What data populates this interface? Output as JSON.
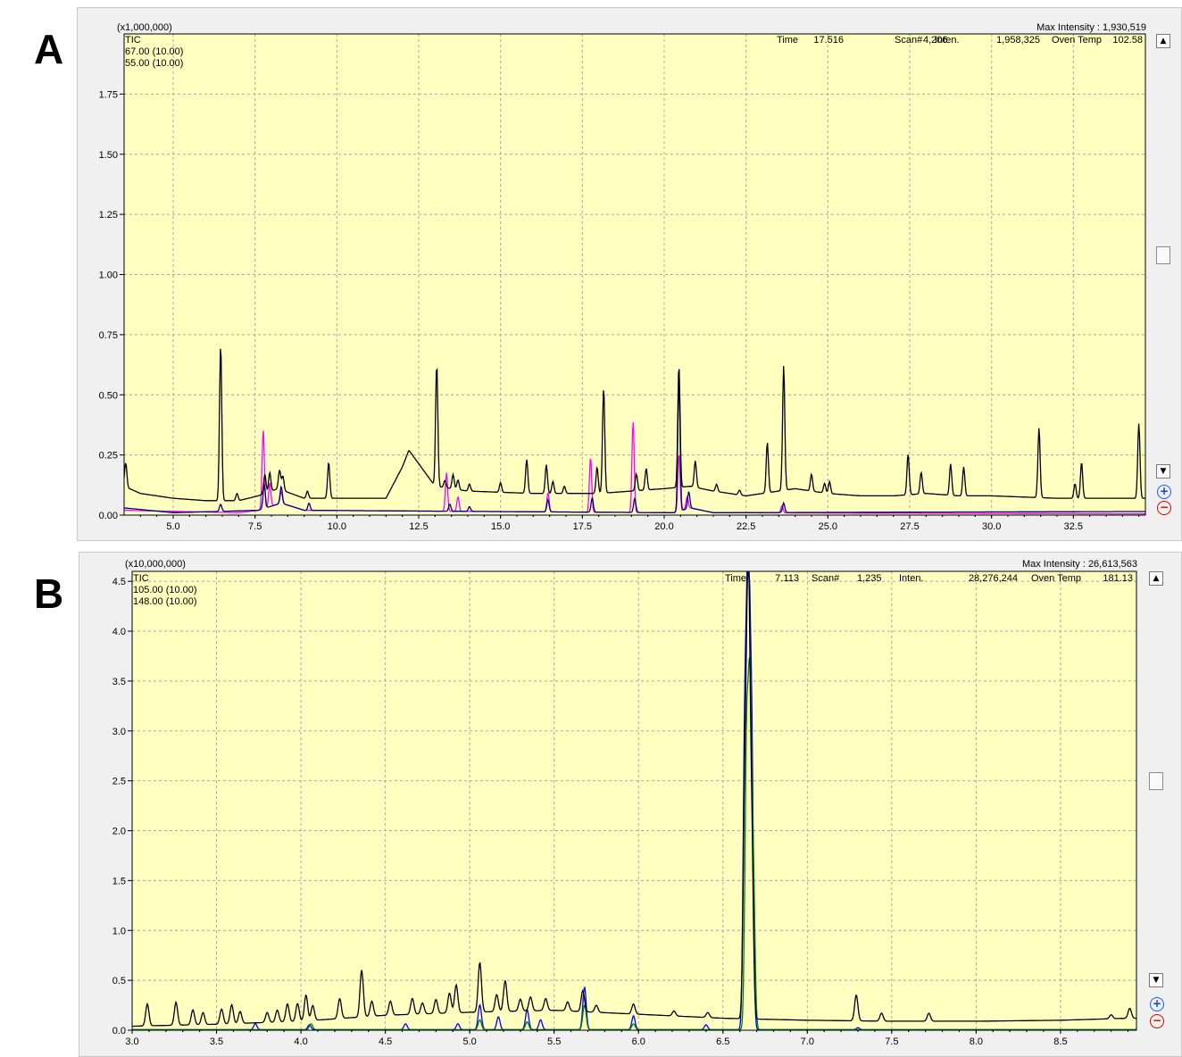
{
  "panels": [
    {
      "letter": "A",
      "y_multiplier": "(x1,000,000)",
      "max_intensity": "Max Intensity : 1,930,519",
      "status": {
        "time_label": "Time",
        "time": "17.516",
        "scan_label": "Scan#",
        "scan": "4,206",
        "inten_label": "Inten.",
        "inten": "1,958,325",
        "oven_label": "Oven Temp",
        "oven": "102.58"
      },
      "legend": [
        {
          "label": "TIC",
          "color": "#000000"
        },
        {
          "label": "67.00 (10.00)",
          "color": "#ff00ff"
        },
        {
          "label": "55.00 (10.00)",
          "color": "#000080"
        }
      ]
    },
    {
      "letter": "B",
      "y_multiplier": "(x10,000,000)",
      "max_intensity": "Max Intensity : 26,613,563",
      "status": {
        "time_label": "Time",
        "time": "7.113",
        "scan_label": "Scan#",
        "scan": "1,235",
        "inten_label": "Inten.",
        "inten": "28,276,244",
        "oven_label": "Oven Temp",
        "oven": "181.13"
      },
      "legend": [
        {
          "label": "TIC",
          "color": "#000000"
        },
        {
          "label": "105.00 (10.00)",
          "color": "#0000ff"
        },
        {
          "label": "148.00 (10.00)",
          "color": "#008000"
        }
      ]
    }
  ],
  "chart_data": [
    {
      "type": "line",
      "panel": "A",
      "xlim": [
        3.5,
        34.7
      ],
      "ylim": [
        0,
        2.0
      ],
      "x_ticks": [
        5.0,
        7.5,
        10.0,
        12.5,
        15.0,
        17.5,
        20.0,
        22.5,
        25.0,
        27.5,
        30.0,
        32.5
      ],
      "y_ticks": [
        0.0,
        0.25,
        0.5,
        0.75,
        1.0,
        1.25,
        1.5,
        1.75
      ],
      "x_tick_labels": [
        "5.0",
        "7.5",
        "10.0",
        "12.5",
        "15.0",
        "17.5",
        "20.0",
        "22.5",
        "25.0",
        "27.5",
        "30.0",
        "32.5"
      ],
      "y_tick_labels": [
        "0.00",
        "0.25",
        "0.50",
        "0.75",
        "1.00",
        "1.25",
        "1.50",
        "1.75"
      ],
      "grid": true,
      "background": "#ffffc0",
      "series": [
        {
          "name": "TIC",
          "color": "#000000",
          "baseline": [
            [
              3.5,
              0.12
            ],
            [
              4.0,
              0.09
            ],
            [
              5.0,
              0.07
            ],
            [
              6.0,
              0.06
            ],
            [
              7.0,
              0.06
            ],
            [
              7.6,
              0.08
            ],
            [
              8.2,
              0.11
            ],
            [
              9.0,
              0.07
            ],
            [
              10.0,
              0.07
            ],
            [
              11.5,
              0.07
            ],
            [
              12.0,
              0.2
            ],
            [
              12.2,
              0.27
            ],
            [
              13.0,
              0.12
            ],
            [
              14.0,
              0.1
            ],
            [
              16.0,
              0.09
            ],
            [
              18.0,
              0.09
            ],
            [
              19.0,
              0.1
            ],
            [
              20.0,
              0.11
            ],
            [
              20.8,
              0.12
            ],
            [
              21.5,
              0.1
            ],
            [
              22.5,
              0.08
            ],
            [
              23.5,
              0.1
            ],
            [
              24.0,
              0.11
            ],
            [
              25.0,
              0.09
            ],
            [
              26.0,
              0.08
            ],
            [
              27.0,
              0.08
            ],
            [
              28.0,
              0.09
            ],
            [
              29.0,
              0.08
            ],
            [
              30.0,
              0.08
            ],
            [
              32.0,
              0.07
            ],
            [
              34.6,
              0.07
            ]
          ],
          "peaks": [
            [
              3.55,
              0.1
            ],
            [
              6.45,
              0.65
            ],
            [
              6.95,
              0.03
            ],
            [
              7.8,
              0.08
            ],
            [
              7.95,
              0.08
            ],
            [
              8.25,
              0.08
            ],
            [
              8.35,
              0.06
            ],
            [
              9.1,
              0.03
            ],
            [
              9.75,
              0.15
            ],
            [
              13.05,
              0.51
            ],
            [
              13.3,
              0.03
            ],
            [
              13.55,
              0.06
            ],
            [
              13.7,
              0.04
            ],
            [
              14.05,
              0.03
            ],
            [
              15.0,
              0.04
            ],
            [
              15.8,
              0.14
            ],
            [
              16.4,
              0.12
            ],
            [
              16.6,
              0.05
            ],
            [
              16.95,
              0.03
            ],
            [
              17.95,
              0.11
            ],
            [
              18.15,
              0.44
            ],
            [
              19.15,
              0.07
            ],
            [
              19.45,
              0.09
            ],
            [
              20.45,
              0.51
            ],
            [
              20.95,
              0.11
            ],
            [
              21.6,
              0.03
            ],
            [
              22.3,
              0.02
            ],
            [
              23.15,
              0.21
            ],
            [
              23.65,
              0.52
            ],
            [
              24.5,
              0.07
            ],
            [
              24.9,
              0.04
            ],
            [
              25.05,
              0.05
            ],
            [
              27.45,
              0.17
            ],
            [
              27.85,
              0.09
            ],
            [
              28.75,
              0.13
            ],
            [
              29.15,
              0.12
            ],
            [
              31.45,
              0.29
            ],
            [
              32.55,
              0.06
            ],
            [
              32.75,
              0.15
            ],
            [
              34.5,
              0.31
            ]
          ]
        },
        {
          "name": "67.00 (10.00)",
          "color": "#ff00ff",
          "baseline": [
            [
              3.5,
              0.02
            ],
            [
              7.0,
              0.01
            ],
            [
              7.6,
              0.02
            ],
            [
              8.3,
              0.05
            ],
            [
              9.0,
              0.02
            ],
            [
              20.3,
              0.01
            ],
            [
              20.8,
              0.03
            ],
            [
              21.5,
              0.01
            ],
            [
              34.6,
              0.005
            ]
          ],
          "peaks": [
            [
              7.75,
              0.33
            ],
            [
              7.95,
              0.1
            ],
            [
              8.3,
              0.05
            ],
            [
              13.35,
              0.16
            ],
            [
              13.7,
              0.06
            ],
            [
              16.45,
              0.08
            ],
            [
              17.75,
              0.23
            ],
            [
              19.05,
              0.38
            ],
            [
              20.45,
              0.24
            ],
            [
              20.7,
              0.05
            ],
            [
              23.6,
              0.03
            ]
          ]
        },
        {
          "name": "55.00 (10.00)",
          "color": "#000080",
          "baseline": [
            [
              3.5,
              0.03
            ],
            [
              5.0,
              0.01
            ],
            [
              7.6,
              0.02
            ],
            [
              8.3,
              0.05
            ],
            [
              9.0,
              0.02
            ],
            [
              20.3,
              0.01
            ],
            [
              20.8,
              0.03
            ],
            [
              21.5,
              0.01
            ],
            [
              34.6,
              0.015
            ]
          ],
          "peaks": [
            [
              6.45,
              0.03
            ],
            [
              7.78,
              0.1
            ],
            [
              8.3,
              0.07
            ],
            [
              9.15,
              0.03
            ],
            [
              13.45,
              0.03
            ],
            [
              14.05,
              0.02
            ],
            [
              16.45,
              0.05
            ],
            [
              17.8,
              0.06
            ],
            [
              19.1,
              0.06
            ],
            [
              20.45,
              0.55
            ],
            [
              20.75,
              0.07
            ],
            [
              23.65,
              0.04
            ]
          ]
        }
      ]
    },
    {
      "type": "line",
      "panel": "B",
      "xlim": [
        3.0,
        8.95
      ],
      "ylim": [
        0,
        4.6
      ],
      "x_ticks": [
        3.0,
        3.5,
        4.0,
        4.5,
        5.0,
        5.5,
        6.0,
        6.5,
        7.0,
        7.5,
        8.0,
        8.5
      ],
      "y_ticks": [
        0.0,
        0.5,
        1.0,
        1.5,
        2.0,
        2.5,
        3.0,
        3.5,
        4.0,
        4.5
      ],
      "x_tick_labels": [
        "3.0",
        "3.5",
        "4.0",
        "4.5",
        "5.0",
        "5.5",
        "6.0",
        "6.5",
        "7.0",
        "7.5",
        "8.0",
        "8.5"
      ],
      "y_tick_labels": [
        "0.0",
        "0.5",
        "1.0",
        "1.5",
        "2.0",
        "2.5",
        "3.0",
        "3.5",
        "4.0",
        "4.5"
      ],
      "grid": true,
      "background": "#ffffc0",
      "series": [
        {
          "name": "TIC",
          "color": "#000000",
          "baseline": [
            [
              3.0,
              0.04
            ],
            [
              3.5,
              0.06
            ],
            [
              4.0,
              0.09
            ],
            [
              4.5,
              0.15
            ],
            [
              5.0,
              0.18
            ],
            [
              5.5,
              0.2
            ],
            [
              6.0,
              0.16
            ],
            [
              6.5,
              0.12
            ],
            [
              7.0,
              0.1
            ],
            [
              7.5,
              0.09
            ],
            [
              8.0,
              0.09
            ],
            [
              8.5,
              0.1
            ],
            [
              8.9,
              0.12
            ]
          ],
          "peaks": [
            [
              3.09,
              0.22
            ],
            [
              3.26,
              0.23
            ],
            [
              3.36,
              0.15
            ],
            [
              3.42,
              0.12
            ],
            [
              3.53,
              0.15
            ],
            [
              3.59,
              0.19
            ],
            [
              3.64,
              0.12
            ],
            [
              3.8,
              0.1
            ],
            [
              3.86,
              0.12
            ],
            [
              3.92,
              0.18
            ],
            [
              3.98,
              0.18
            ],
            [
              4.03,
              0.26
            ],
            [
              4.07,
              0.15
            ],
            [
              4.23,
              0.2
            ],
            [
              4.36,
              0.47
            ],
            [
              4.42,
              0.15
            ],
            [
              4.53,
              0.14
            ],
            [
              4.66,
              0.16
            ],
            [
              4.72,
              0.11
            ],
            [
              4.8,
              0.14
            ],
            [
              4.88,
              0.2
            ],
            [
              4.92,
              0.28
            ],
            [
              5.06,
              0.5
            ],
            [
              5.16,
              0.17
            ],
            [
              5.21,
              0.31
            ],
            [
              5.3,
              0.12
            ],
            [
              5.36,
              0.14
            ],
            [
              5.45,
              0.12
            ],
            [
              5.58,
              0.09
            ],
            [
              5.67,
              0.21
            ],
            [
              5.75,
              0.07
            ],
            [
              5.97,
              0.1
            ],
            [
              6.21,
              0.05
            ],
            [
              6.41,
              0.05
            ],
            [
              6.63,
              2.25
            ],
            [
              6.65,
              4.3
            ],
            [
              6.67,
              1.8
            ],
            [
              7.29,
              0.26
            ],
            [
              7.44,
              0.08
            ],
            [
              7.72,
              0.08
            ],
            [
              8.8,
              0.04
            ],
            [
              8.91,
              0.1
            ]
          ]
        },
        {
          "name": "105.00 (10.00)",
          "color": "#0000ff",
          "baseline": [
            [
              3.0,
              0.005
            ],
            [
              8.95,
              0.005
            ]
          ],
          "peaks": [
            [
              3.73,
              0.06
            ],
            [
              4.05,
              0.05
            ],
            [
              4.62,
              0.06
            ],
            [
              4.93,
              0.06
            ],
            [
              5.06,
              0.25
            ],
            [
              5.17,
              0.13
            ],
            [
              5.34,
              0.2
            ],
            [
              5.42,
              0.1
            ],
            [
              5.68,
              0.43
            ],
            [
              5.97,
              0.14
            ],
            [
              6.4,
              0.05
            ],
            [
              6.63,
              3.0
            ],
            [
              6.65,
              4.45
            ],
            [
              6.67,
              2.9
            ],
            [
              7.3,
              0.02
            ]
          ]
        },
        {
          "name": "148.00 (10.00)",
          "color": "#008000",
          "baseline": [
            [
              3.0,
              0.005
            ],
            [
              8.95,
              0.005
            ]
          ],
          "peaks": [
            [
              4.06,
              0.06
            ],
            [
              5.06,
              0.1
            ],
            [
              5.34,
              0.08
            ],
            [
              5.68,
              0.25
            ],
            [
              5.97,
              0.06
            ],
            [
              6.64,
              2.8
            ],
            [
              6.66,
              3.2
            ],
            [
              6.68,
              1.5
            ]
          ]
        }
      ]
    }
  ]
}
